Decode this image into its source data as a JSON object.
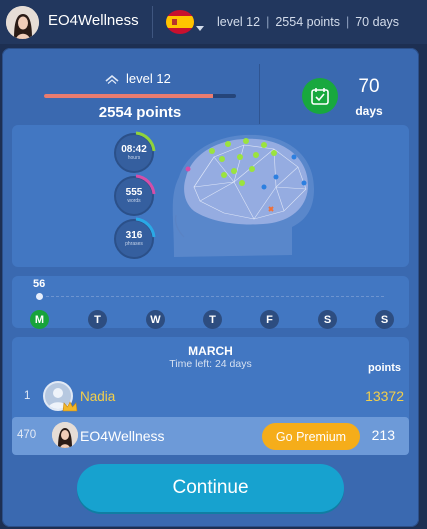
{
  "header": {
    "username": "EO4Wellness",
    "language_flag": "spain-flag-icon",
    "level": "level 12",
    "points": "2554 points",
    "days": "70 days"
  },
  "level_card": {
    "level": "level 12",
    "points": "2554 points",
    "progress": 0.88,
    "days_value": "70",
    "days_label": "days"
  },
  "brain_stats": [
    {
      "value": "08:42",
      "label": "hours",
      "accent": "#8fd33c"
    },
    {
      "value": "555",
      "label": "words",
      "accent": "#d44ea8"
    },
    {
      "value": "316",
      "label": "phrases",
      "accent": "#2aa9e6"
    }
  ],
  "week": {
    "count": "56",
    "days": [
      {
        "label": "M",
        "active": true
      },
      {
        "label": "T",
        "active": false
      },
      {
        "label": "W",
        "active": false
      },
      {
        "label": "T",
        "active": false
      },
      {
        "label": "F",
        "active": false
      },
      {
        "label": "S",
        "active": false
      },
      {
        "label": "S",
        "active": false
      }
    ]
  },
  "leaderboard": {
    "month": "MARCH",
    "time_left": "Time left: 24 days",
    "points_header": "points",
    "rows": [
      {
        "rank": "1",
        "name": "Nadia",
        "score": "13372"
      },
      {
        "rank": "470",
        "name": "EO4Wellness",
        "score": "213"
      }
    ],
    "premium_label": "Go Premium"
  },
  "continue_label": "Continue",
  "colors": {
    "accent_green": "#17a33b",
    "premium_orange": "#f5ad1a",
    "continue_blue": "#17a2cf",
    "leader_gold": "#f3cf4a",
    "progress_red": "#e97c70"
  }
}
